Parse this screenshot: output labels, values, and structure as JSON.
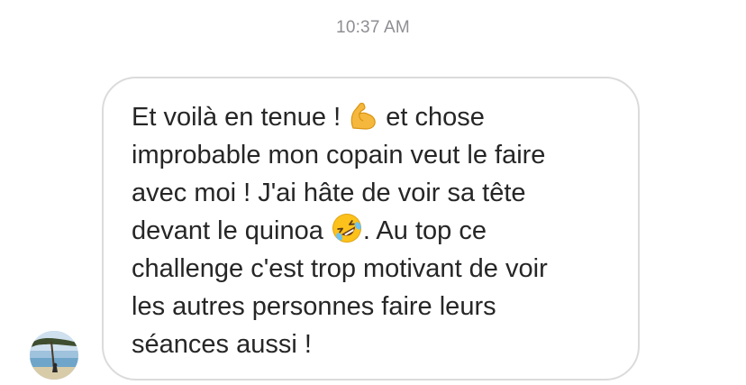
{
  "conversation": {
    "timestamp": "10:37 AM"
  },
  "message": {
    "sender_avatar_icon": "user-avatar-photo",
    "lines": {
      "l1_before": "Et voilà en tenue ! ",
      "l1_after": " et chose",
      "l2": "improbable mon copain veut le faire",
      "l3": "avec moi ! J'ai hâte de voir sa tête",
      "l4_before": "devant le quinoa ",
      "l4_after": ". Au top ce",
      "l5": "challenge c'est trop motivant de voir",
      "l6": "les autres personnes faire leurs",
      "l7": "séances aussi !"
    },
    "emojis": [
      "flexed-biceps-icon",
      "rolling-on-floor-laughing-icon"
    ]
  },
  "colors": {
    "text": "#262626",
    "timestamp": "#8e8e93",
    "bubble_border": "#dbdbdb"
  }
}
